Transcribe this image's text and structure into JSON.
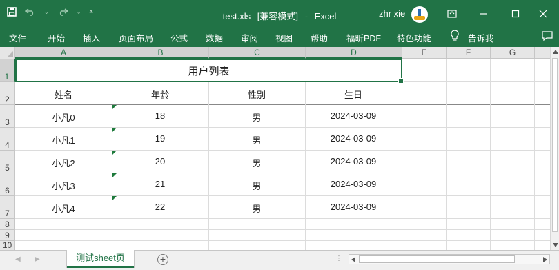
{
  "window": {
    "file_name": "test.xls",
    "mode": "[兼容模式]",
    "separator": "-",
    "app_name": "Excel",
    "user": "zhr xie"
  },
  "qat": {
    "save_icon": "save-icon",
    "undo_icon": "undo-icon",
    "redo_icon": "redo-icon",
    "customize_icon": "customize-qat-icon"
  },
  "menu": {
    "items": [
      "文件",
      "开始",
      "插入",
      "页面布局",
      "公式",
      "数据",
      "审阅",
      "视图",
      "帮助",
      "福昕PDF",
      "特色功能"
    ],
    "tell_me": "告诉我"
  },
  "columns": [
    "A",
    "B",
    "C",
    "D",
    "E",
    "F",
    "G"
  ],
  "rows": [
    "1",
    "2",
    "3",
    "4",
    "5",
    "6",
    "7",
    "8",
    "9",
    "10"
  ],
  "sheet": {
    "title": "用户列表",
    "headers": [
      "姓名",
      "年龄",
      "性别",
      "生日"
    ],
    "records": [
      [
        "小凡0",
        "18",
        "男",
        "2024-03-09"
      ],
      [
        "小凡1",
        "19",
        "男",
        "2024-03-09"
      ],
      [
        "小凡2",
        "20",
        "男",
        "2024-03-09"
      ],
      [
        "小凡3",
        "21",
        "男",
        "2024-03-09"
      ],
      [
        "小凡4",
        "22",
        "男",
        "2024-03-09"
      ]
    ]
  },
  "tabs": {
    "active": "测试sheet页",
    "add_symbol": "+"
  },
  "colors": {
    "accent": "#217346",
    "number_as_text_indicator": "#1e7a3c"
  }
}
